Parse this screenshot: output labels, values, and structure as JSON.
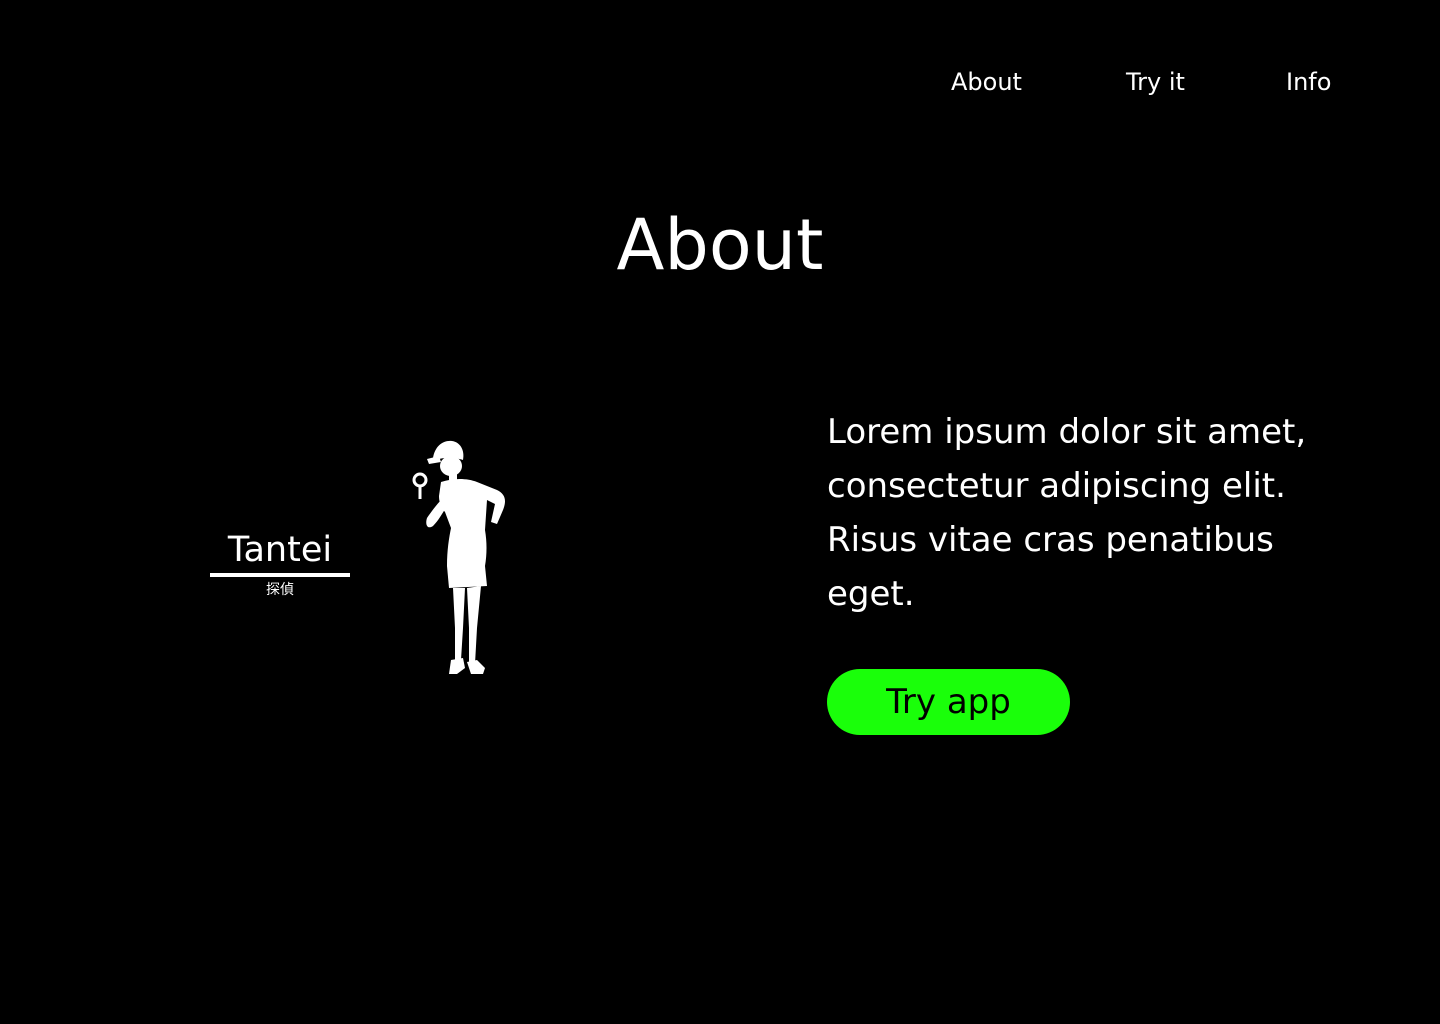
{
  "nav": {
    "items": [
      {
        "label": "About"
      },
      {
        "label": "Try it"
      },
      {
        "label": "Info"
      }
    ]
  },
  "main": {
    "title": "About",
    "description": "Lorem ipsum dolor sit amet, consectetur adipiscing elit. Risus vitae cras penatibus eget.",
    "cta_label": "Try app"
  },
  "logo": {
    "name": "Tantei",
    "subtitle": "探偵"
  },
  "colors": {
    "background": "#000000",
    "text": "#ffffff",
    "accent": "#1aff0a"
  },
  "illustration": {
    "icon": "detective-silhouette-icon"
  }
}
